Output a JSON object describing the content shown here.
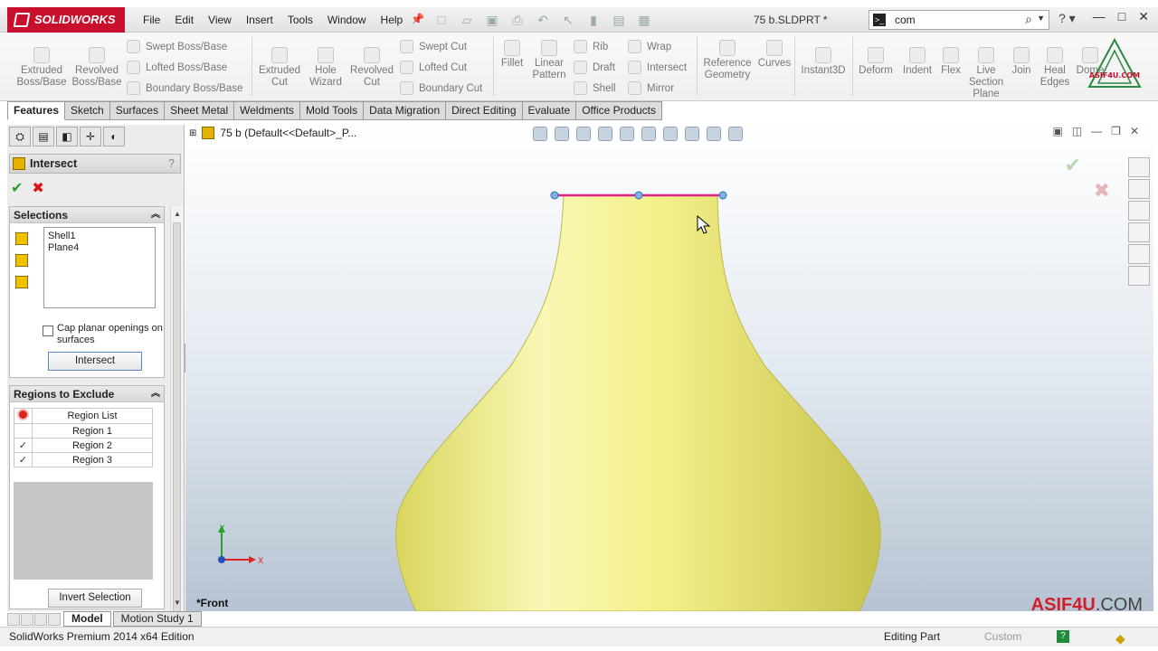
{
  "app": {
    "brand": "SOLIDWORKS",
    "menu": [
      "File",
      "Edit",
      "View",
      "Insert",
      "Tools",
      "Window",
      "Help"
    ],
    "document_title": "75 b.SLDPRT *",
    "search_value": "com"
  },
  "command_manager": {
    "big_buttons": [
      "Extruded Boss/Base",
      "Revolved Boss/Base",
      "Extruded Cut",
      "Hole Wizard",
      "Revolved Cut",
      "Fillet",
      "Linear Pattern",
      "Reference Geometry",
      "Curves",
      "Instant3D",
      "Deform",
      "Indent",
      "Flex",
      "Live Section Plane",
      "Join",
      "Heal Edges",
      "Dome"
    ],
    "boss_rows": [
      "Swept Boss/Base",
      "Lofted Boss/Base",
      "Boundary Boss/Base"
    ],
    "cut_rows": [
      "Swept Cut",
      "Lofted Cut",
      "Boundary Cut"
    ],
    "misc_col1": [
      "Rib",
      "Draft",
      "Shell"
    ],
    "misc_col2": [
      "Wrap",
      "Intersect",
      "Mirror"
    ]
  },
  "tabs": [
    "Features",
    "Sketch",
    "Surfaces",
    "Sheet Metal",
    "Weldments",
    "Mold Tools",
    "Data Migration",
    "Direct Editing",
    "Evaluate",
    "Office Products"
  ],
  "property_manager": {
    "title": "Intersect",
    "help": "?",
    "selections": {
      "header": "Selections",
      "items": [
        "Shell1",
        "Plane4"
      ],
      "cap_label": "Cap planar openings on surfaces",
      "button": "Intersect"
    },
    "regions": {
      "header": "Regions to Exclude",
      "column": "Region List",
      "rows": [
        {
          "label": "Region   1",
          "checked": ""
        },
        {
          "label": "Region   2",
          "checked": "✓"
        },
        {
          "label": "Region   3",
          "checked": "✓"
        }
      ],
      "invert_button": "Invert Selection"
    }
  },
  "viewport": {
    "tree_label": "75 b  (Default<<Default>_P...",
    "view_name": "*Front",
    "axis_y": "Y",
    "axis_x": "X",
    "watermark_main": "ASIF4U",
    "watermark_suffix": ".COM",
    "logo_text": "ASIF4U.COM"
  },
  "bottom_tabs": [
    "Model",
    "Motion Study 1"
  ],
  "status": {
    "edition": "SolidWorks Premium 2014 x64 Edition",
    "mode": "Editing Part",
    "units": "Custom",
    "help_icon": "?"
  },
  "colors": {
    "brand_red": "#c8102e",
    "model_yellow": "#f6f38a",
    "accept_green": "#2a9d2a",
    "cancel_red": "#d11"
  }
}
